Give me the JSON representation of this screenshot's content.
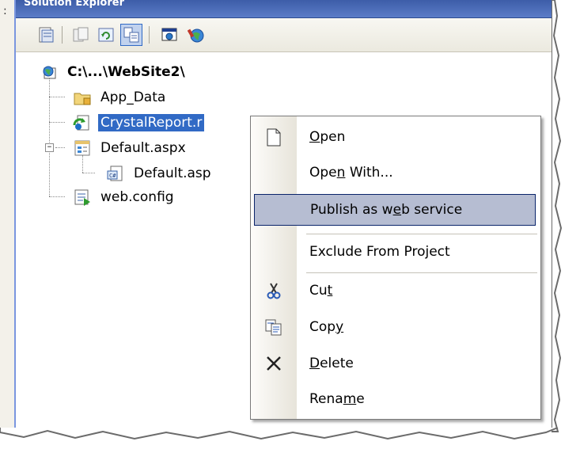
{
  "panel": {
    "title": "Solution Explorer"
  },
  "toolbar": {
    "buttons": [
      {
        "icon": "properties-icon"
      },
      {
        "icon": "show-all-files-icon"
      },
      {
        "icon": "refresh-icon"
      },
      {
        "icon": "nest-related-files-icon"
      },
      {
        "icon": "view-designer-icon"
      },
      {
        "icon": "asp-net-configuration-icon"
      }
    ]
  },
  "tree": {
    "root": "C:\\...\\WebSite2\\",
    "items": {
      "app_data": "App_Data",
      "crystal_report": "CrystalReport.r",
      "default_aspx": "Default.aspx",
      "default_aspx_cs": "Default.asp",
      "web_config": "web.config"
    }
  },
  "context_menu": {
    "open": {
      "pre": "",
      "u": "O",
      "post": "pen"
    },
    "open_with": {
      "pre": "Ope",
      "u": "n",
      "post": " With..."
    },
    "publish": {
      "pre": "Publish as w",
      "u": "e",
      "post": "b service"
    },
    "exclude": {
      "pre": "Exclude From Project",
      "u": "",
      "post": ""
    },
    "cut": {
      "pre": "Cu",
      "u": "t",
      "post": ""
    },
    "copy": {
      "pre": "Cop",
      "u": "y",
      "post": ""
    },
    "delete": {
      "pre": "",
      "u": "D",
      "post": "elete"
    },
    "rename": {
      "pre": "Rena",
      "u": "m",
      "post": "e"
    }
  }
}
